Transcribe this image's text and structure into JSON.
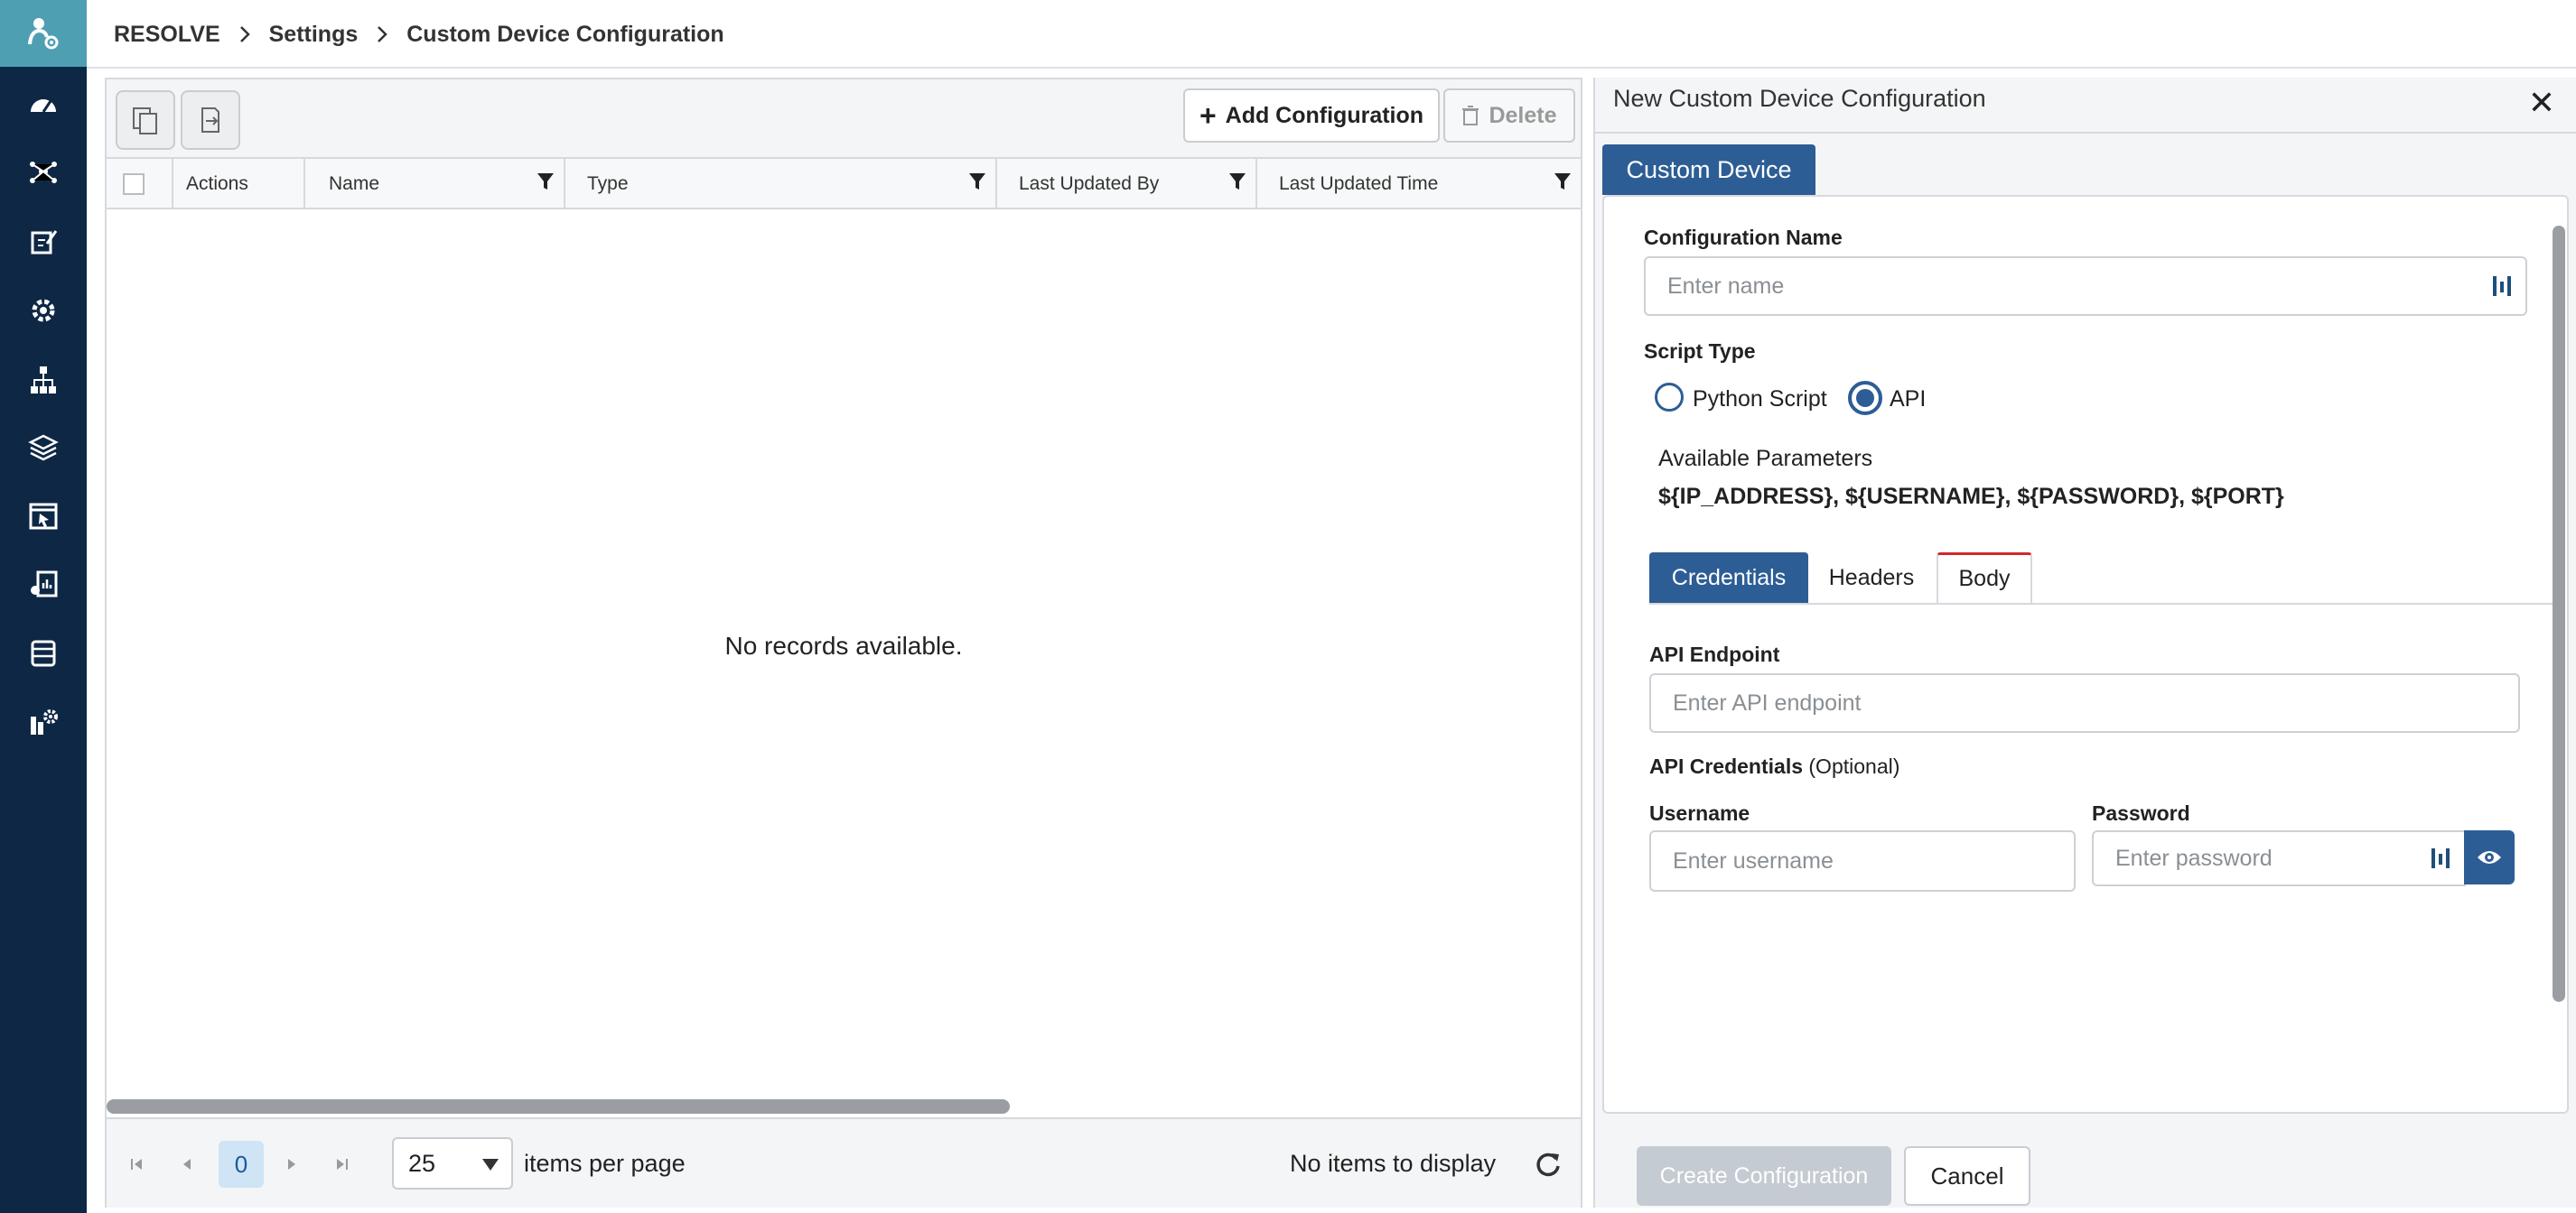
{
  "colors": {
    "sidebar_bg": "#0e2745",
    "logo_bg": "#4f9fb3",
    "accent": "#2d5d95",
    "active_tab_indicator": "#d0282d",
    "disabled_button": "#c5cbd3"
  },
  "sidebar": {
    "logo_icon": "resolve-logo-icon",
    "items": [
      {
        "icon": "dashboard-gauge-icon"
      },
      {
        "icon": "workflow-icon"
      },
      {
        "icon": "edit-document-icon"
      },
      {
        "icon": "automation-gear-icon"
      },
      {
        "icon": "network-topology-icon"
      },
      {
        "icon": "layers-icon"
      },
      {
        "icon": "window-pointer-icon"
      },
      {
        "icon": "reports-icon"
      },
      {
        "icon": "database-icon"
      },
      {
        "icon": "settings-icon"
      }
    ]
  },
  "breadcrumb": {
    "items": [
      "RESOLVE",
      "Settings",
      "Custom Device Configuration"
    ]
  },
  "grid": {
    "toolbar": {
      "copy_icon": "copy-icon",
      "export_icon": "export-icon",
      "add_label": "Add Configuration",
      "delete_label": "Delete"
    },
    "columns": [
      "Actions",
      "Name",
      "Type",
      "Last Updated By",
      "Last Updated Time"
    ],
    "empty_message": "No records available.",
    "pager": {
      "current_page": "0",
      "page_size": "25",
      "items_per_page_label": "items per page",
      "status": "No items to display"
    }
  },
  "form": {
    "title": "New Custom Device Configuration",
    "close": "✕",
    "tab_label": "Custom Device",
    "config_name_label": "Configuration Name",
    "config_name_placeholder": "Enter name",
    "script_type_label": "Script Type",
    "script_options": [
      "Python Script",
      "API"
    ],
    "selected_script": "API",
    "available_params_label": "Available Parameters",
    "available_params": "${IP_ADDRESS}, ${USERNAME}, ${PASSWORD}, ${PORT}",
    "subtabs": [
      "Credentials",
      "Headers",
      "Body"
    ],
    "active_subtab": "Credentials",
    "api_endpoint_label": "API Endpoint",
    "api_endpoint_placeholder": "Enter API endpoint",
    "api_credentials_label": "API Credentials",
    "api_credentials_optional": "(Optional)",
    "username_label": "Username",
    "username_placeholder": "Enter username",
    "password_label": "Password",
    "password_placeholder": "Enter password",
    "create_label": "Create Configuration",
    "cancel_label": "Cancel"
  }
}
